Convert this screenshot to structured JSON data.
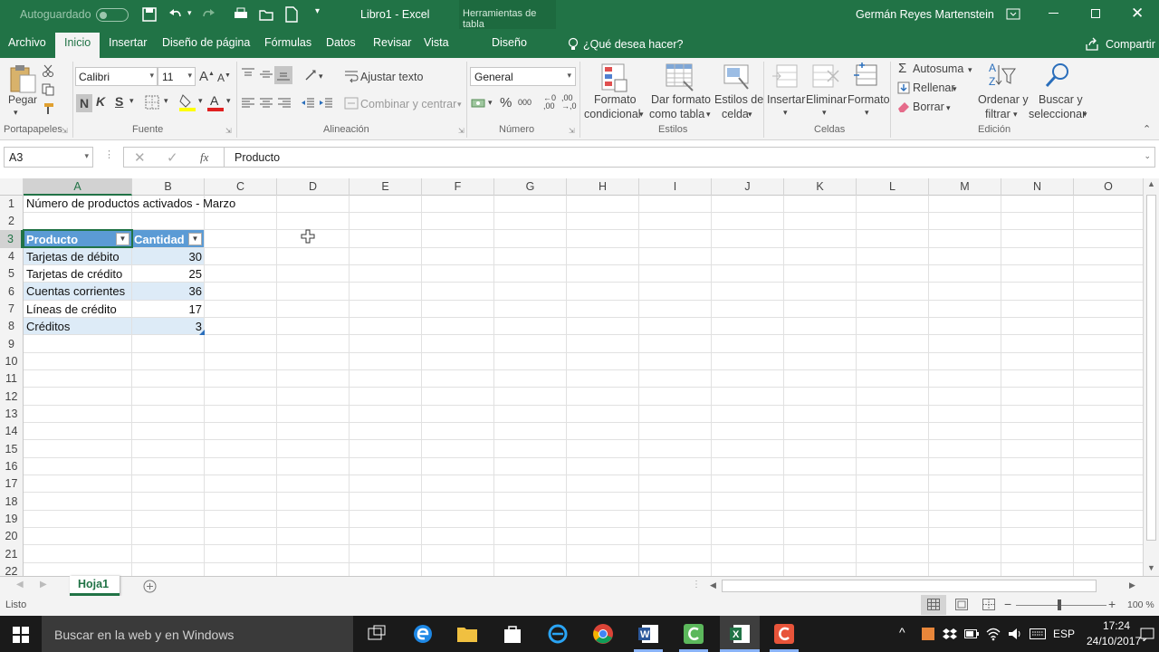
{
  "titlebar": {
    "autosave_label": "Autoguardado",
    "autosave_state": "off",
    "title": "Libro1  -  Excel",
    "context_tools": "Herramientas de tabla",
    "user": "Germán Reyes Martenstein"
  },
  "tabs": [
    "Archivo",
    "Inicio",
    "Insertar",
    "Diseño de página",
    "Fórmulas",
    "Datos",
    "Revisar",
    "Vista",
    "Diseño"
  ],
  "active_tab": "Inicio",
  "tell_me": "¿Qué desea hacer?",
  "share": "Compartir",
  "ribbon": {
    "clipboard": {
      "paste": "Pegar",
      "group": "Portapapeles"
    },
    "font": {
      "name": "Calibri",
      "size": "11",
      "bold": "N",
      "italic": "K",
      "underline": "S",
      "group": "Fuente"
    },
    "alignment": {
      "wrap": "Ajustar texto",
      "merge": "Combinar y centrar",
      "group": "Alineación"
    },
    "number": {
      "format": "General",
      "group": "Número"
    },
    "styles": {
      "cond1": "Formato",
      "cond2": "condicional",
      "table1": "Dar formato",
      "table2": "como tabla",
      "cell1": "Estilos de",
      "cell2": "celda",
      "group": "Estilos"
    },
    "cells": {
      "insert": "Insertar",
      "delete": "Eliminar",
      "format": "Formato",
      "group": "Celdas"
    },
    "editing": {
      "autosum": "Autosuma",
      "fill": "Rellenar",
      "clear": "Borrar",
      "sort1": "Ordenar y",
      "sort2": "filtrar",
      "find1": "Buscar y",
      "find2": "seleccionar",
      "group": "Edición"
    }
  },
  "formula_bar": {
    "name_box": "A3",
    "fx": "fx",
    "content": "Producto"
  },
  "columns": [
    "A",
    "B",
    "C",
    "D",
    "E",
    "F",
    "G",
    "H",
    "I",
    "J",
    "K",
    "L",
    "M",
    "N",
    "O"
  ],
  "rows": [
    "1",
    "2",
    "3",
    "4",
    "5",
    "6",
    "7",
    "8",
    "9",
    "10",
    "11",
    "12",
    "13",
    "14",
    "15",
    "16",
    "17",
    "18",
    "19",
    "20",
    "21",
    "22"
  ],
  "sheet": {
    "title_cell": "Número de productos activados - Marzo",
    "table_headers": [
      "Producto",
      "Cantidad"
    ],
    "table_rows": [
      {
        "producto": "Tarjetas de débito",
        "cantidad": "30"
      },
      {
        "producto": "Tarjetas de crédito",
        "cantidad": "25"
      },
      {
        "producto": "Cuentas corrientes",
        "cantidad": "36"
      },
      {
        "producto": "Líneas de crédito",
        "cantidad": "17"
      },
      {
        "producto": "Créditos",
        "cantidad": "3"
      }
    ]
  },
  "sheet_tabs": [
    "Hoja1"
  ],
  "status": {
    "ready": "Listo",
    "zoom": "100 %"
  },
  "taskbar": {
    "search": "Buscar en la web y en Windows",
    "lang": "ESP",
    "time": "17:24",
    "date": "24/10/2017"
  },
  "colors": {
    "excel_green": "#217346",
    "table_header": "#5b9bd5",
    "band": "#ddebf7"
  }
}
